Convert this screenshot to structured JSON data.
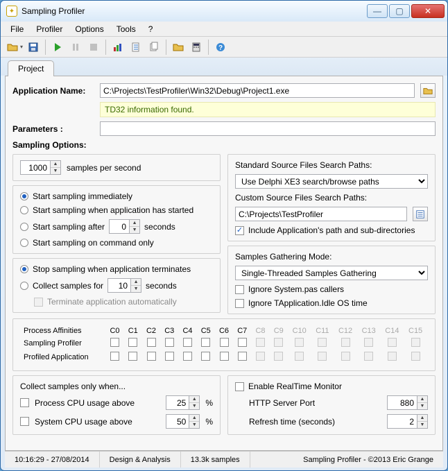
{
  "window": {
    "title": "Sampling Profiler"
  },
  "menu": {
    "file": "File",
    "profiler": "Profiler",
    "options": "Options",
    "tools": "Tools",
    "help": "?"
  },
  "tabs": {
    "project": "Project"
  },
  "form": {
    "app_name_label": "Application Name:",
    "app_name_value": "C:\\Projects\\TestProfiler\\Win32\\Debug\\Project1.exe",
    "info_text": "TD32 information found.",
    "params_label": "Parameters :",
    "params_value": ""
  },
  "sampling": {
    "header": "Sampling Options:",
    "rate_value": "1000",
    "rate_unit": "samples per second",
    "start_immediate": "Start sampling immediately",
    "start_when_started": "Start sampling when application has started",
    "start_after": "Start sampling after",
    "start_after_value": "0",
    "seconds": "seconds",
    "start_command": "Start sampling on command only",
    "stop_terminates": "Stop sampling when application terminates",
    "collect_for": "Collect samples for",
    "collect_for_value": "10",
    "terminate_auto": "Terminate application automatically"
  },
  "paths": {
    "std_label": "Standard Source Files Search Paths:",
    "std_value": "Use Delphi XE3 search/browse paths",
    "custom_label": "Custom Source Files Search Paths:",
    "custom_value": "C:\\Projects\\TestProfiler",
    "include_app_path": "Include Application's path and sub-directories"
  },
  "gather": {
    "label": "Samples Gathering Mode:",
    "value": "Single-Threaded Samples Gathering",
    "ignore_system": "Ignore System.pas callers",
    "ignore_idle": "Ignore TApplication.Idle OS time"
  },
  "affinity": {
    "title": "Process Affinities",
    "row1": "Sampling Profiler",
    "row2": "Profiled Application",
    "cores": [
      "C0",
      "C1",
      "C2",
      "C3",
      "C4",
      "C5",
      "C6",
      "C7",
      "C8",
      "C9",
      "C10",
      "C11",
      "C12",
      "C13",
      "C14",
      "C15"
    ],
    "enabled_count": 8
  },
  "collect_when": {
    "title": "Collect samples only when...",
    "process_cpu": "Process CPU usage above",
    "process_val": "25",
    "system_cpu": "System CPU usage above",
    "system_val": "50",
    "pct": "%"
  },
  "realtime": {
    "enable": "Enable RealTime Monitor",
    "port_label": "HTTP Server Port",
    "port_value": "880",
    "refresh_label": "Refresh time (seconds)",
    "refresh_value": "2"
  },
  "status": {
    "time": "10:16:29 - 27/08/2014",
    "mode": "Design & Analysis",
    "samples": "13.3k samples",
    "copyright": "Sampling Profiler - ©2013 Eric Grange"
  }
}
